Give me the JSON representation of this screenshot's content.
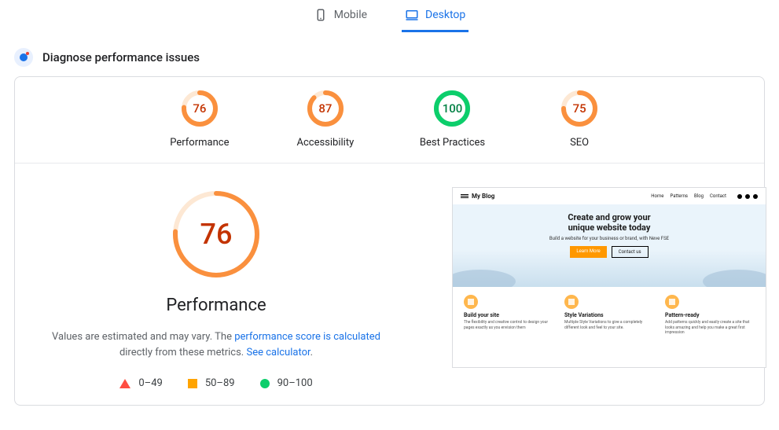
{
  "tabs": {
    "mobile": "Mobile",
    "desktop": "Desktop"
  },
  "diagnose_title": "Diagnose performance issues",
  "scores": [
    {
      "label": "Performance",
      "value": 76,
      "color": "orange"
    },
    {
      "label": "Accessibility",
      "value": 87,
      "color": "orange"
    },
    {
      "label": "Best Practices",
      "value": 100,
      "color": "green"
    },
    {
      "label": "SEO",
      "value": 75,
      "color": "orange"
    }
  ],
  "detail": {
    "score": 76,
    "title": "Performance",
    "desc_before": "Values are estimated and may vary. The ",
    "link1": "performance score is calculated",
    "desc_mid": " directly from these metrics. ",
    "link2": "See calculator",
    "desc_after": "."
  },
  "legend": {
    "bad": "0–49",
    "mid": "50–89",
    "good": "90–100"
  },
  "preview": {
    "site_name": "My Blog",
    "nav": [
      "Home",
      "Patterns",
      "Blog",
      "Contact"
    ],
    "hero_h1_line1": "Create and grow your",
    "hero_h1_line2": "unique website today",
    "hero_sub": "Build a website for your business or brand, with Neve FSE",
    "btn1": "Learn More",
    "btn2": "Contact us",
    "features": [
      {
        "title": "Build your site",
        "text": "The flexibility and creative control to design your pages exactly as you envision them"
      },
      {
        "title": "Style Variations",
        "text": "Multiple Style Variations to give a completely different look and feel to your site."
      },
      {
        "title": "Pattern-ready",
        "text": "Add patterns quickly and easily create a site that looks amazing and help you make a great first impression"
      }
    ]
  }
}
